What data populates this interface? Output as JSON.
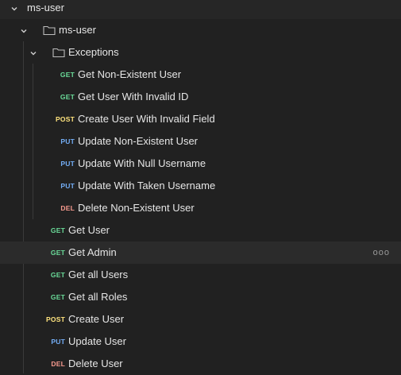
{
  "tree": {
    "root_label": "ms-user",
    "folder_label": "ms-user",
    "subfolder_label": "Exceptions",
    "exceptions": [
      {
        "method": "GET",
        "label": "Get Non-Existent User"
      },
      {
        "method": "GET",
        "label": "Get User With Invalid ID"
      },
      {
        "method": "POST",
        "label": "Create User With Invalid Field"
      },
      {
        "method": "PUT",
        "label": "Update Non-Existent User"
      },
      {
        "method": "PUT",
        "label": "Update With Null Username"
      },
      {
        "method": "PUT",
        "label": "Update With Taken Username"
      },
      {
        "method": "DEL",
        "label": "Delete Non-Existent User"
      }
    ],
    "requests": [
      {
        "method": "GET",
        "label": "Get User"
      },
      {
        "method": "GET",
        "label": "Get Admin"
      },
      {
        "method": "GET",
        "label": "Get all Users"
      },
      {
        "method": "GET",
        "label": "Get all Roles"
      },
      {
        "method": "POST",
        "label": "Create User"
      },
      {
        "method": "PUT",
        "label": "Update User"
      },
      {
        "method": "DEL",
        "label": "Delete User"
      }
    ],
    "more_label": "ooo"
  },
  "colors": {
    "background": "#212121",
    "get": "#6bdd9a",
    "post": "#ffe47e",
    "put": "#74aef6",
    "del": "#f79a8e"
  },
  "icons": {
    "expand": "chevron-down-icon",
    "folder": "folder-icon",
    "more": "more-options-icon"
  }
}
